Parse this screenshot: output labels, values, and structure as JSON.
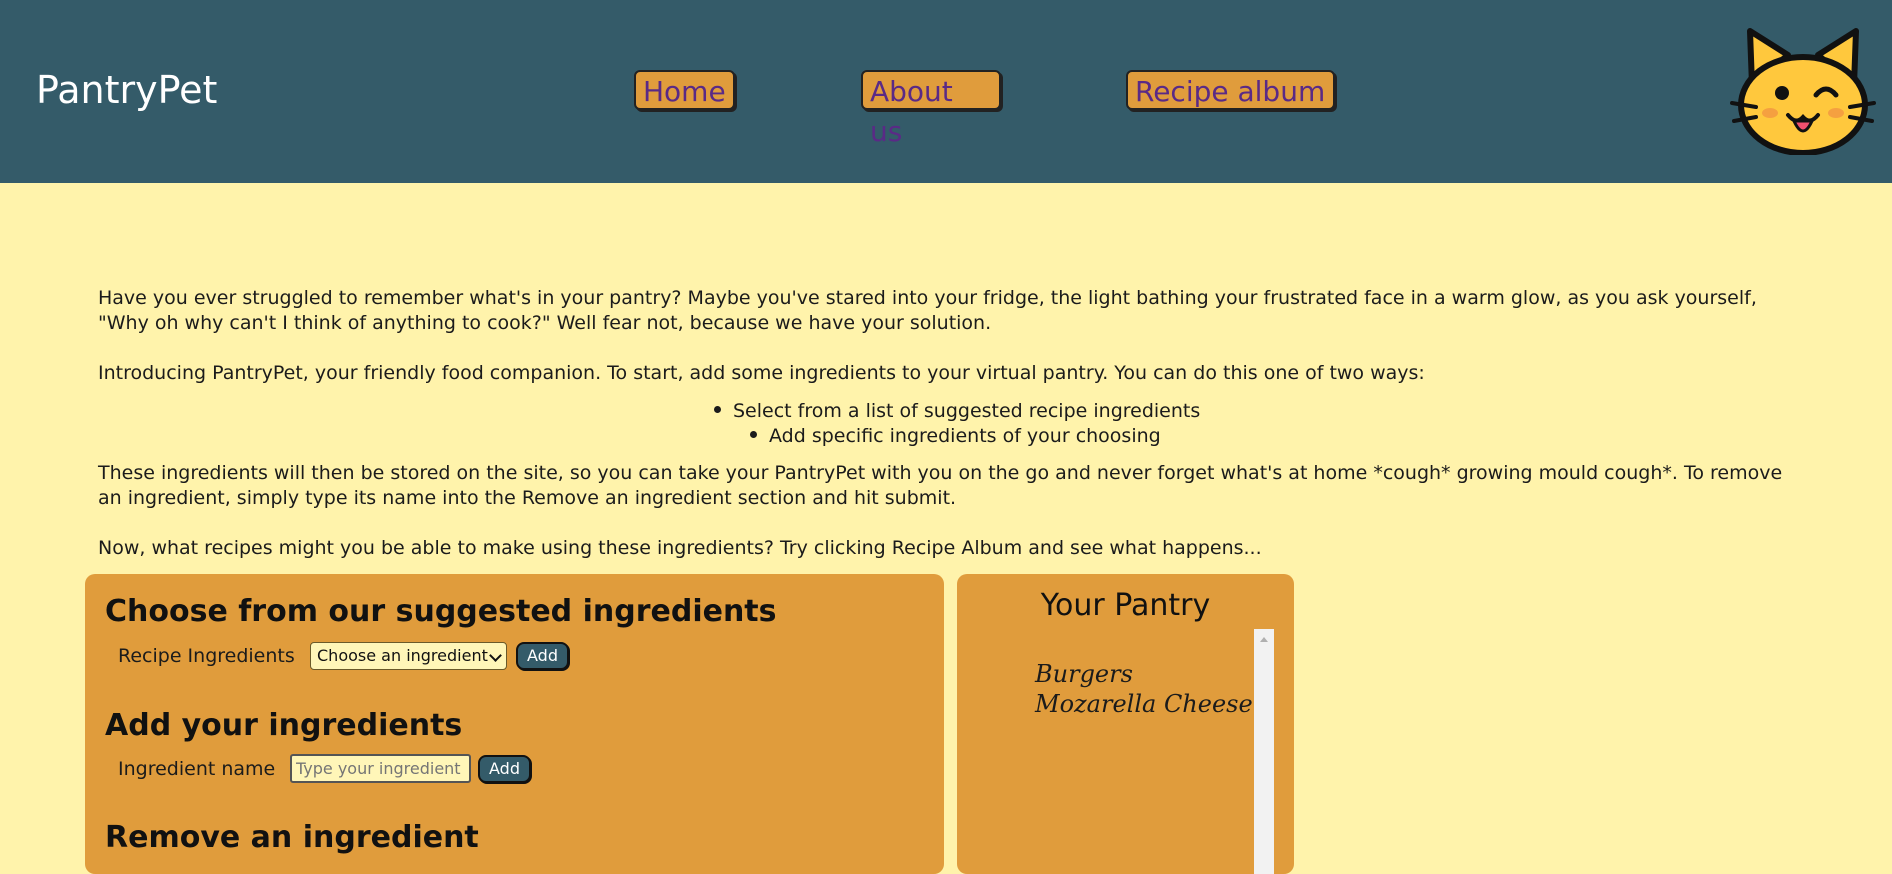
{
  "header": {
    "brand": "PantryPet",
    "nav": [
      {
        "label": "Home"
      },
      {
        "label": "About us"
      },
      {
        "label": "Recipe album"
      }
    ],
    "logo_icon": "winking-cat-face-icon"
  },
  "intro": {
    "paragraph1": "Have you ever struggled to remember what's in your pantry? Maybe you've stared into your fridge, the light bathing your frustrated face in a warm glow, as you ask yourself, \"Why oh why can't I think of anything to cook?\" Well fear not, because we have your solution.",
    "paragraph2": "Introducing PantryPet, your friendly food companion. To start, add some ingredients to your virtual pantry. You can do this one of two ways:",
    "bullets": [
      "Select from a list of suggested recipe ingredients",
      "Add specific ingredients of your choosing"
    ],
    "paragraph3": "These ingredients will then be stored on the site, so you can take your PantryPet with you on the go and never forget what's at home *cough* growing mould cough*. To remove an ingredient, simply type its name into the Remove an ingredient section and hit submit.",
    "paragraph4": "Now, what recipes might you be able to make using these ingredients? Try clicking Recipe Album and see what happens..."
  },
  "suggested": {
    "title": "Choose from our suggested ingredients",
    "label": "Recipe Ingredients",
    "select_value": "Choose an ingredient",
    "add_label": "Add"
  },
  "custom": {
    "title": "Add your ingredients",
    "label": "Ingredient name",
    "placeholder": "Type your ingredient",
    "add_label": "Add"
  },
  "remove": {
    "title": "Remove an ingredient"
  },
  "pantry": {
    "title": "Your Pantry",
    "items": [
      "Burgers",
      "Mozarella Cheese"
    ]
  },
  "colors": {
    "header_bg": "#345b69",
    "page_bg": "#fff3ab",
    "panel_bg": "#e09c3c",
    "nav_text": "#5a2a86"
  }
}
